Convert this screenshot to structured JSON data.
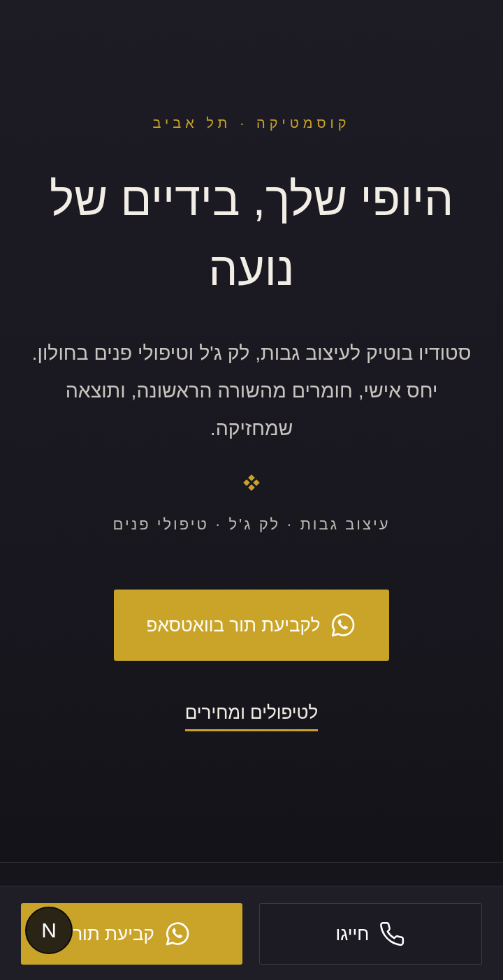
{
  "hero": {
    "eyebrow": "קוסמטיקה · תל אביב",
    "title": "היופי שלך, בידיים של נועה",
    "description": "סטודיו בוטיק לעיצוב גבות, לק ג'ל וטיפולי פנים בחולון. יחס אישי, חומרים מהשורה הראשונה, ותוצאה שמחזיקה.",
    "services": "עיצוב גבות · לק ג'ל · טיפולי פנים",
    "primary_button": {
      "label": "לקביעת תור בוואטסאפ"
    },
    "secondary_link": {
      "label": "לטיפולים ומחירים"
    }
  },
  "bottom_bar": {
    "buttons": [
      {
        "kind": "call",
        "label": "חייגו"
      },
      {
        "kind": "whatsapp",
        "label": "קביעת תור"
      }
    ]
  },
  "floating_badge": {
    "label": "N"
  }
}
